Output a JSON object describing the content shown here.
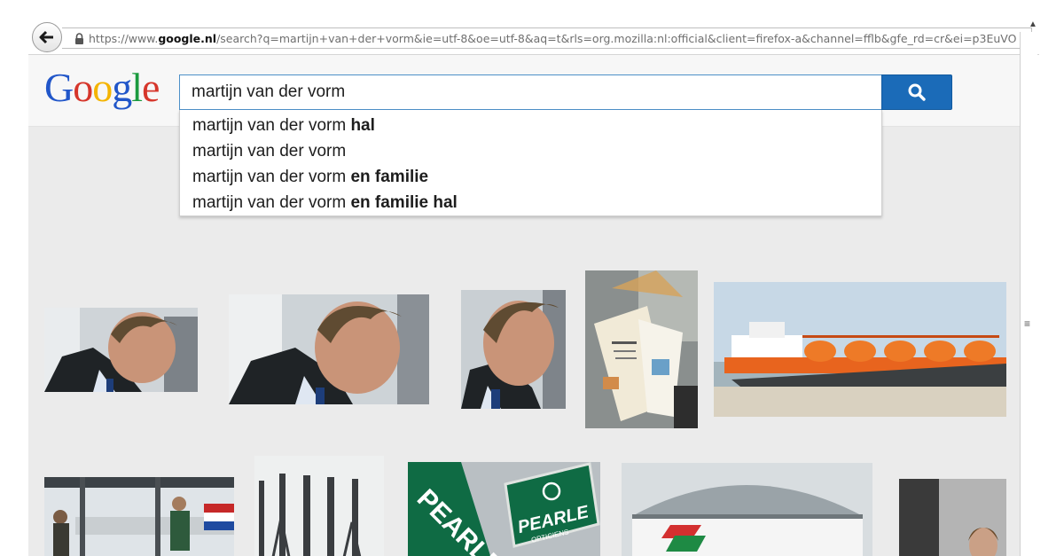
{
  "browser": {
    "url_prefix": "https://www.",
    "url_domain": "google.nl",
    "url_rest": "/search?q=martijn+van+der+vorm&ie=utf-8&oe=utf-8&aq=t&rls=org.mozilla:nl:official&client=firefox-a&channel=fflb&gfe_rd=cr&ei=p3EuVO"
  },
  "logo": {
    "letters": [
      "G",
      "o",
      "o",
      "g",
      "l",
      "e"
    ]
  },
  "search": {
    "query": "martijn van der vorm",
    "suggestions": [
      {
        "base": "martijn van der vorm ",
        "bold": "hal"
      },
      {
        "base": "martijn van der vorm",
        "bold": ""
      },
      {
        "base": "martijn van der vorm ",
        "bold": "en familie"
      },
      {
        "base": "martijn van der vorm ",
        "bold": "en familie hal"
      }
    ]
  },
  "images": {
    "sign_text": "PEARLE",
    "sign_sub": "OPTICIENS",
    "big_sign_text": "PEARLE"
  },
  "colors": {
    "search_button": "#1b6bb8",
    "ship_orange": "#e8641e",
    "pearle_green": "#0f6b44"
  }
}
